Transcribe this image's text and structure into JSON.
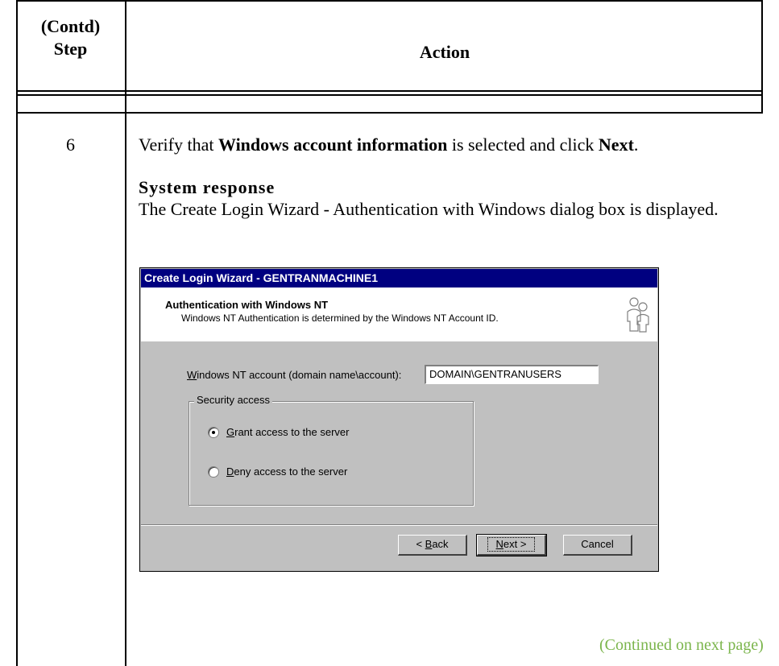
{
  "table": {
    "header_step_line1": "(Contd)",
    "header_step_line2": "Step",
    "header_action": "Action",
    "step_number": "6"
  },
  "instruction": {
    "pre": "Verify that ",
    "bold1": "Windows account information",
    "mid": " is selected and click ",
    "bold2": "Next",
    "post": "."
  },
  "system_response": {
    "heading": "System response",
    "body": "The Create Login Wizard - Authentication with Windows dialog box is displayed."
  },
  "dialog": {
    "title": "Create Login Wizard - GENTRANMACHINE1",
    "header_title": "Authentication with Windows NT",
    "header_subtitle": "Windows NT Authentication is determined by the Windows NT Account ID.",
    "header_icon": "users-icon",
    "account_label_mnemonic": "W",
    "account_label_rest": "indows NT account (domain name\\account):",
    "account_value": "DOMAIN\\GENTRANUSERS",
    "group_title": "Security access",
    "grant": {
      "mnemonic": "G",
      "rest": "rant access to the server",
      "selected": true
    },
    "deny": {
      "mnemonic": "D",
      "rest": "eny access to the server",
      "selected": false
    },
    "buttons": {
      "back_pre": "< ",
      "back_mnemonic": "B",
      "back_rest": "ack",
      "next_mnemonic": "N",
      "next_rest": "ext >",
      "cancel": "Cancel"
    }
  },
  "footer": {
    "continued": "(Continued on next page)",
    "continued_color": "#7bb54c"
  }
}
